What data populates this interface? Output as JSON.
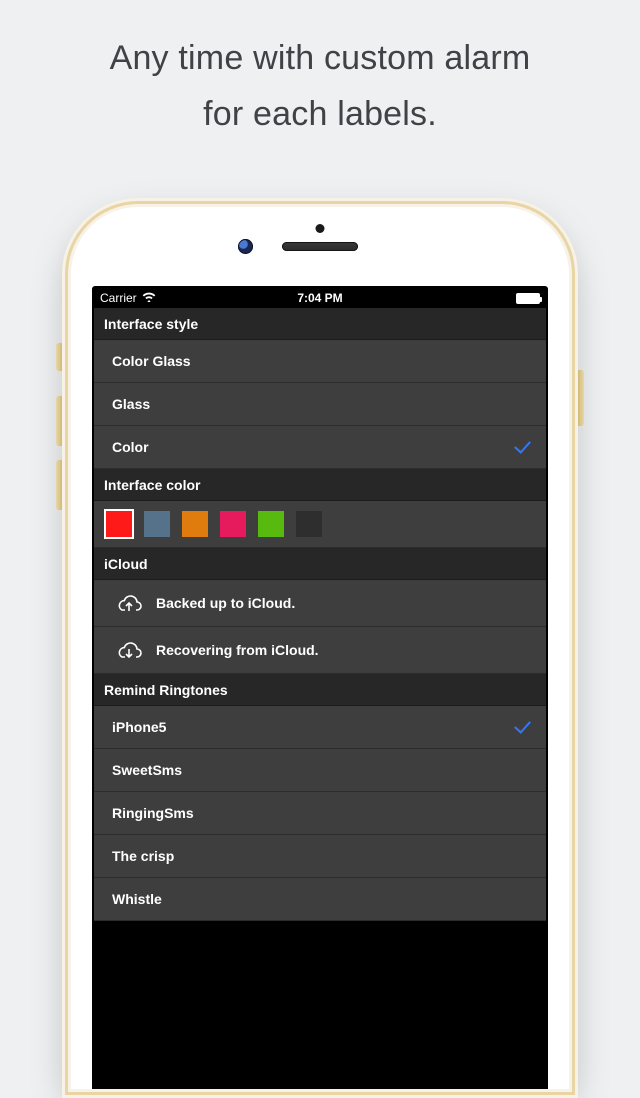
{
  "headline_line1": "Any time with custom alarm",
  "headline_line2": "for each labels.",
  "statusbar": {
    "carrier": "Carrier",
    "time": "7:04 PM"
  },
  "sections": {
    "interface_style": {
      "title": "Interface style",
      "items": [
        "Color Glass",
        "Glass",
        "Color"
      ],
      "selected_index": 2
    },
    "interface_color": {
      "title": "Interface color",
      "swatches": [
        "#ff1a1a",
        "#56728b",
        "#e07b0d",
        "#e51b5d",
        "#58b90f",
        "#2e2e2e"
      ],
      "selected_index": 0
    },
    "icloud": {
      "title": "iCloud",
      "backup": "Backed up to iCloud.",
      "restore": "Recovering from iCloud."
    },
    "ringtones": {
      "title": "Remind Ringtones",
      "items": [
        "iPhone5",
        "SweetSms",
        "RingingSms",
        "The crisp",
        "Whistle"
      ],
      "selected_index": 0
    }
  }
}
